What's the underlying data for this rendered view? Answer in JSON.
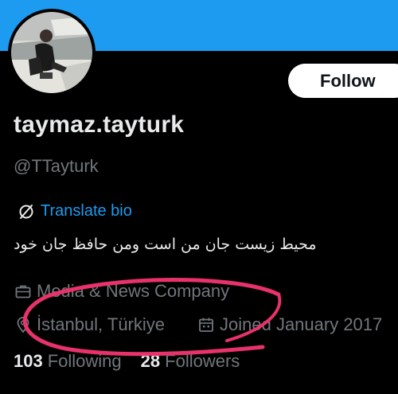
{
  "profile": {
    "display_name": "taymaz.tayturk",
    "handle": "@TTayturk",
    "translate_label": "Translate bio",
    "bio": "محیط زیست جان من است ومن حافظ جان خود",
    "category": "Media & News Company",
    "location": "İstanbul, Türkiye",
    "joined": "Joined January 2017",
    "following_count": "103",
    "following_label": "Following",
    "followers_count": "28",
    "followers_label": "Followers"
  },
  "actions": {
    "follow_label": "Follow"
  },
  "icons": {
    "translate": "translate-icon",
    "briefcase": "briefcase-icon",
    "location": "location-pin-icon",
    "calendar": "calendar-icon"
  },
  "colors": {
    "banner": "#1d9bf0",
    "link": "#1d9bf0",
    "muted": "#71767b",
    "text": "#e7e9ea",
    "annotation": "#e8326b"
  }
}
